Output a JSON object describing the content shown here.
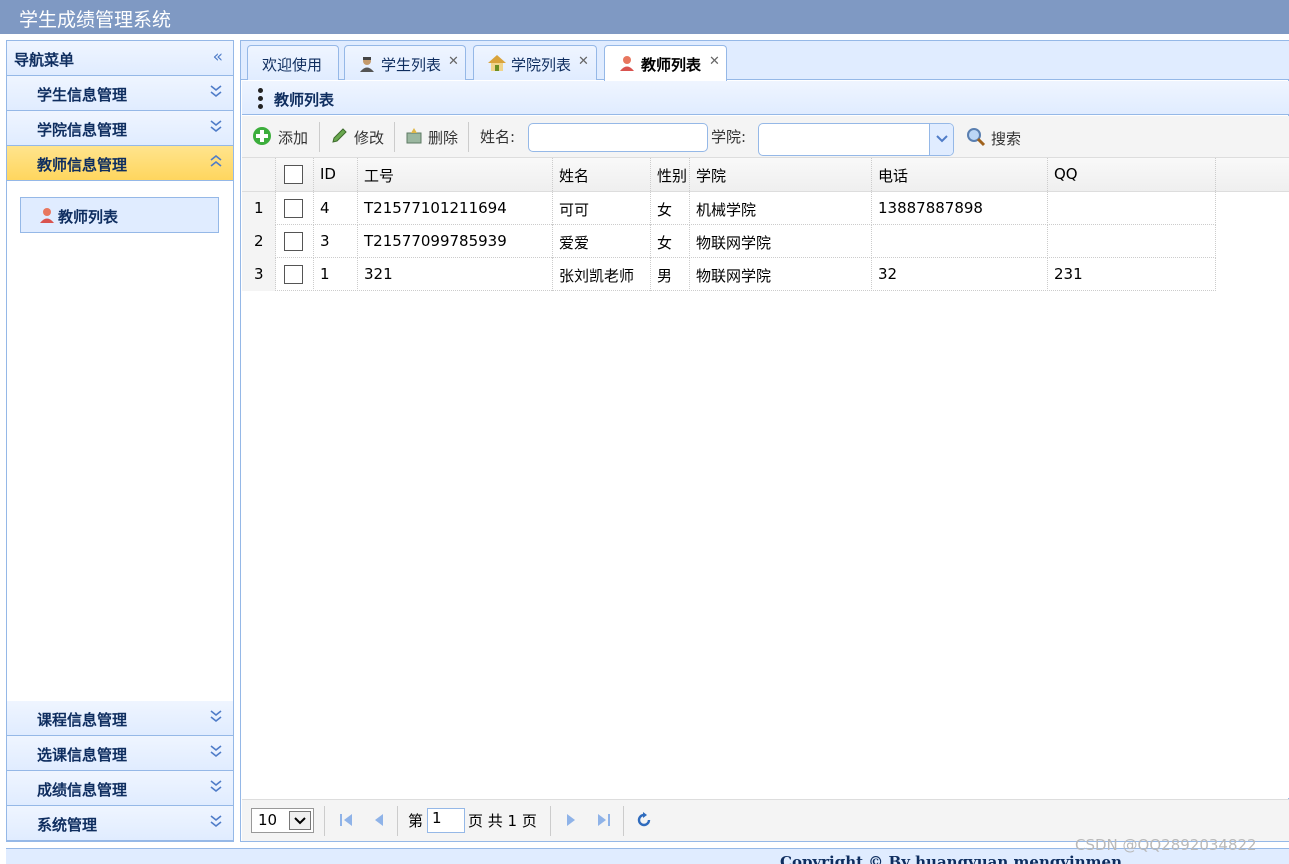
{
  "app": {
    "title": "学生成绩管理系统"
  },
  "nav": {
    "title": "导航菜单",
    "sections": [
      {
        "label": "学生信息管理"
      },
      {
        "label": "学院信息管理"
      },
      {
        "label": "教师信息管理"
      },
      {
        "label": "课程信息管理"
      },
      {
        "label": "选课信息管理"
      },
      {
        "label": "成绩信息管理"
      },
      {
        "label": "系统管理"
      }
    ],
    "active_link": "教师列表"
  },
  "tabs": [
    {
      "label": "欢迎使用",
      "icon": ""
    },
    {
      "label": "学生列表",
      "icon": "student-icon"
    },
    {
      "label": "学院列表",
      "icon": "house-icon"
    },
    {
      "label": "教师列表",
      "icon": "teacher-icon"
    }
  ],
  "panel": {
    "title": "教师列表"
  },
  "toolbar": {
    "add_label": "添加",
    "edit_label": "修改",
    "delete_label": "删除",
    "name_label": "姓名:",
    "name_value": "",
    "college_label": "学院:",
    "college_value": "",
    "search_label": "搜索"
  },
  "table": {
    "columns": [
      "ID",
      "工号",
      "姓名",
      "性别",
      "学院",
      "电话",
      "QQ"
    ],
    "rows": [
      {
        "num": "1",
        "id": "4",
        "no": "T21577101211694",
        "name": "可可",
        "gender": "女",
        "college": "机械学院",
        "phone": "13887887898",
        "qq": ""
      },
      {
        "num": "2",
        "id": "3",
        "no": "T21577099785939",
        "name": "爱爱",
        "gender": "女",
        "college": "物联网学院",
        "phone": "",
        "qq": ""
      },
      {
        "num": "3",
        "id": "1",
        "no": "321",
        "name": "张刘凯老师",
        "gender": "男",
        "college": "物联网学院",
        "phone": "32",
        "qq": "231"
      }
    ]
  },
  "pager": {
    "page_size": "10",
    "page_prefix": "第",
    "page_value": "1",
    "page_suffix": "页 共 1 页"
  },
  "footer": {
    "text": "Copyright © By huangyuan mengyinmen"
  },
  "watermark": "CSDN @QQ2892034822",
  "colors": {
    "header": "#7f99c3",
    "border": "#95b8e7",
    "panel_bg": "#e0ecff",
    "active_section": "#ffd65e"
  }
}
